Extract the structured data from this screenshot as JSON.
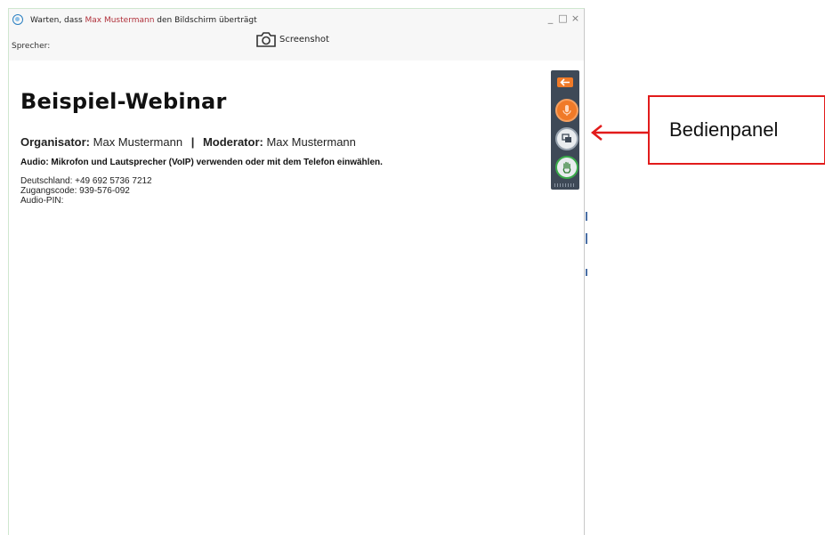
{
  "window": {
    "title_prefix": "Warten, dass ",
    "title_presenter": "Max Mustermann",
    "title_suffix": " den Bildschirm überträgt",
    "minimize_glyph": "_",
    "maximize_glyph": "□",
    "close_glyph": "×",
    "app_icon": "webinar-app-icon"
  },
  "toolbar": {
    "speaker_label": "Sprecher:",
    "screenshot_label": "Screenshot",
    "screenshot_icon": "camera-icon"
  },
  "content": {
    "title": "Beispiel-Webinar",
    "organizer_label": "Organisator:",
    "organizer_name": "Max Mustermann",
    "separator": "|",
    "moderator_label": "Moderator:",
    "moderator_name": "Max Mustermann",
    "audio_info": "Audio: Mikrofon und Lautsprecher (VoIP) verwenden oder mit dem Telefon einwählen.",
    "phone_line": "Deutschland: +49 692 5736 7212",
    "access_code_line": "Zugangscode: 939-576-092",
    "audio_pin_line": "Audio-PIN:"
  },
  "control_panel": {
    "buttons": [
      {
        "icon": "arrow-left-icon"
      },
      {
        "icon": "microphone-icon"
      },
      {
        "icon": "screen-share-icon"
      },
      {
        "icon": "raise-hand-icon"
      }
    ]
  },
  "callout": {
    "label": "Bedienpanel"
  },
  "colors": {
    "accent_orange": "#f07a28",
    "panel_bg": "#3e4957",
    "callout_red": "#e21b1b",
    "presenter_name": "#b0303a"
  }
}
